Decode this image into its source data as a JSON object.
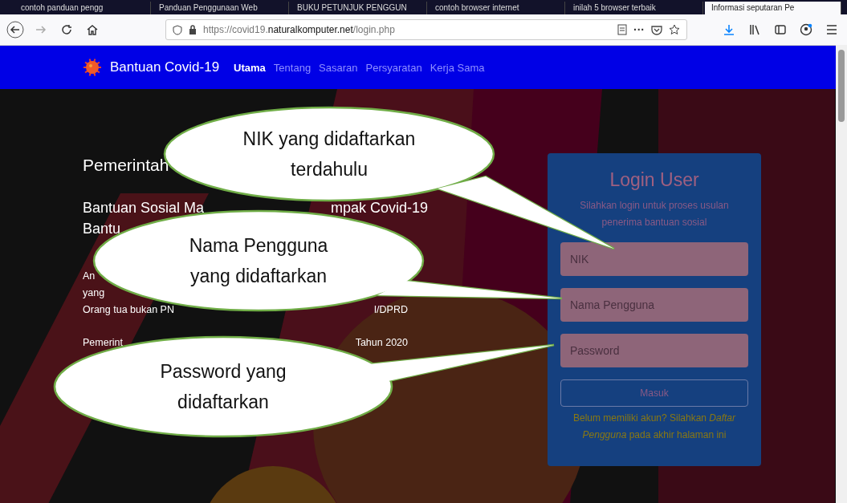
{
  "browser": {
    "tabs": [
      {
        "title": "contoh panduan pengg",
        "selected": false
      },
      {
        "title": "Panduan Penggunaan Web",
        "selected": false
      },
      {
        "title": "BUKU PETUNJUK PENGGUN",
        "selected": false
      },
      {
        "title": "contoh browser internet",
        "selected": false
      },
      {
        "title": "inilah 5 browser terbaik",
        "selected": false
      },
      {
        "title": "Informasi seputaran Pe",
        "selected": true
      }
    ],
    "url": {
      "prefix": "https://covid19.",
      "domain": "naturalkomputer.net",
      "path": "/login.php"
    },
    "menu_dots": "···"
  },
  "site": {
    "brand": "Bantuan Covid-19",
    "nav": [
      {
        "label": "Utama",
        "selected": true
      },
      {
        "label": "Tentang",
        "selected": false
      },
      {
        "label": "Sasaran",
        "selected": false
      },
      {
        "label": "Persyaratan",
        "selected": false
      },
      {
        "label": "Kerja Sama",
        "selected": false
      }
    ]
  },
  "content": [
    {
      "kind": "heading",
      "lines": [
        {
          "left": "Pemerintah"
        }
      ]
    },
    {
      "kind": "subheading",
      "lines": [
        {
          "left": "Bantuan Sosial Ma",
          "right": "mpak Covid-19"
        },
        {
          "left": "Bantu"
        }
      ]
    },
    {
      "kind": "paragraph",
      "lines": [
        {
          "left": "An"
        },
        {
          "left": "yang"
        },
        {
          "left": "Orang tua bukan PN",
          "right": "I/DPRD"
        }
      ]
    },
    {
      "kind": "paragraph",
      "lines": [
        {
          "left": "Pemerint",
          "right": "Tahun 2020"
        }
      ]
    }
  ],
  "login": {
    "title": "Login User",
    "subtitle": "Silahkan login untuk proses usulan penerima bantuan sosial",
    "fields": [
      {
        "placeholder": "NIK"
      },
      {
        "placeholder": "Nama Pengguna"
      },
      {
        "placeholder": "Password"
      }
    ],
    "button": "Masuk",
    "note": "Belum memiliki akun? Silahkan *Daftar Pengguna* pada akhir halaman ini"
  },
  "callouts": [
    {
      "lines": [
        "NIK yang didaftarkan",
        "terdahulu"
      ]
    },
    {
      "lines": [
        "Nama Pengguna",
        "yang didaftarkan"
      ]
    },
    {
      "lines": [
        "Password yang",
        "didaftarkan"
      ]
    }
  ]
}
